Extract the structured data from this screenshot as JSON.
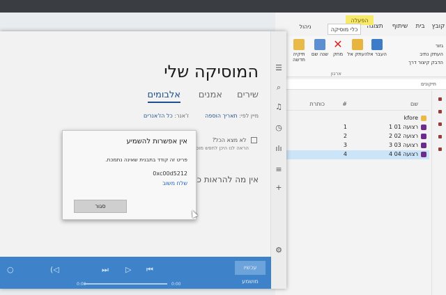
{
  "explorer": {
    "tabs": [
      "קובץ",
      "בית",
      "שיתוף",
      "תצוגה",
      "ניהול"
    ],
    "context_tab": "הפעלה",
    "context_sub": "כלי מוסיקה",
    "ribbon": {
      "buttons": [
        "העבר אל",
        "העתק אל",
        "מחק",
        "שנה שם",
        "תיקיה חדשה"
      ],
      "small": [
        "גזור",
        "העתק נתיב",
        "הדבק קיצור דרך"
      ],
      "group_label": "ארגון"
    },
    "address": "תיקונים",
    "columns": {
      "name": "שם",
      "number": "#",
      "title": "כותרת"
    },
    "rows": [
      {
        "name": "kfore",
        "number": "",
        "type": "folder",
        "selected": false
      },
      {
        "name": "רצועה 01 1",
        "number": "1",
        "type": "track",
        "selected": false
      },
      {
        "name": "רצועה 02 2",
        "number": "2",
        "type": "track",
        "selected": false
      },
      {
        "name": "רצועה 03 3",
        "number": "3",
        "type": "track",
        "selected": false
      },
      {
        "name": "רצועה 04 4",
        "number": "4",
        "type": "track",
        "selected": true
      }
    ]
  },
  "music": {
    "title": "המוסיקה שלי",
    "tabs": [
      {
        "label": "שירים",
        "active": false
      },
      {
        "label": "אמנים",
        "active": false
      },
      {
        "label": "אלבומים",
        "active": true
      }
    ],
    "sort": {
      "prefix": "מיין לפי:",
      "value": "תאריך הוספה",
      "genre": "ז'אנר:",
      "genre_value": "כל הז'אנרים"
    },
    "checkbox_label": "לא מצא הכל?",
    "note": "הראה לנו היכן לחפש מוסיקה",
    "empty_text": "אין מה להראות כאן",
    "player": {
      "now_playing": "עכשיו מושמע",
      "time_start": "0:00",
      "time_end": "0:00"
    }
  },
  "dialog": {
    "title": "אין אפשרות להשמיע",
    "message": "פריט זה קודד בתבנית שאינה נתמכת.",
    "code": "0xc00d5212",
    "feedback_link": "שלח משוב",
    "close_button": "סגור"
  }
}
